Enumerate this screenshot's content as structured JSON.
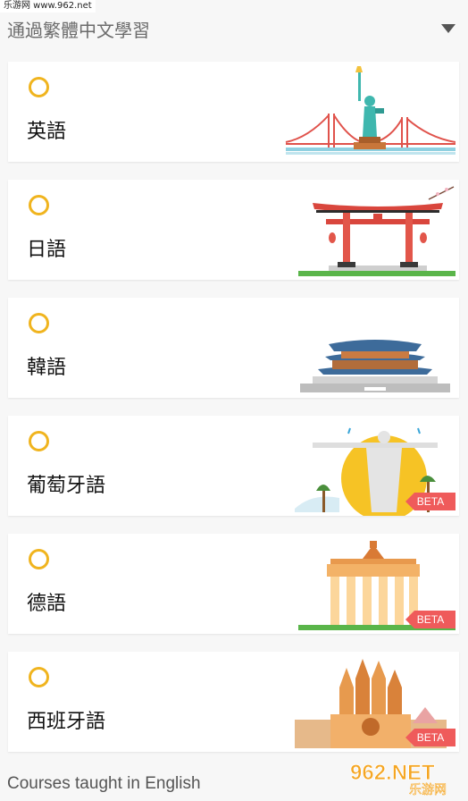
{
  "watermark_top": "乐游网 www.962.net",
  "header": {
    "title": "通過繁體中文學習"
  },
  "courses": [
    {
      "label": "英語",
      "beta": false
    },
    {
      "label": "日語",
      "beta": false
    },
    {
      "label": "韓語",
      "beta": false
    },
    {
      "label": "葡萄牙語",
      "beta": true,
      "beta_label": "BETA"
    },
    {
      "label": "德語",
      "beta": true,
      "beta_label": "BETA"
    },
    {
      "label": "西班牙語",
      "beta": true,
      "beta_label": "BETA"
    }
  ],
  "footer": {
    "text": "Courses taught in English"
  },
  "watermark_bottom": {
    "brand": "962.NET",
    "sub": "乐游网"
  },
  "colors": {
    "radio": "#f0b41e",
    "beta": "#ef5b5b",
    "background": "#f7f7f7"
  }
}
